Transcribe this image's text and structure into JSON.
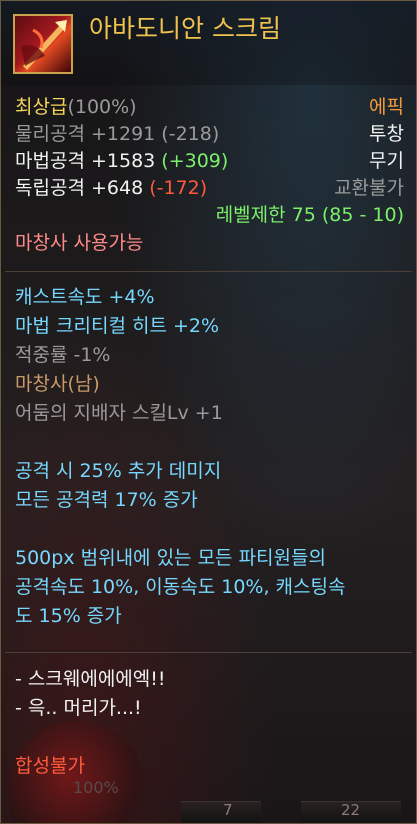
{
  "item": {
    "name": "아바도니안 스크림",
    "grade_label": "최상급",
    "grade_pct": "(100%)",
    "rarity": "에픽",
    "category_1": "투창",
    "category_2": "무기",
    "trade": "교환불가",
    "level_limit": "레벨제한 75 (85 - 10)",
    "usable": "마창사 사용가능",
    "accent_colors": {
      "name": "#f0c24e",
      "rarity": "#f39a3c",
      "plus": "#7cf06a",
      "minus": "#ff5a3c",
      "option": "#76d8ff"
    }
  },
  "stats": [
    {
      "label": "물리공격",
      "value": "+1291",
      "diff": "(-218)",
      "tone": "gray"
    },
    {
      "label": "마법공격",
      "value": "+1583",
      "diff": "(+309)",
      "tone": "white"
    },
    {
      "label": "독립공격",
      "value": "+648",
      "diff": "(-172)",
      "tone": "white"
    }
  ],
  "options": [
    "캐스트속도 +4%",
    "마법 크리티컬 히트 +2%"
  ],
  "extra": {
    "hit_rate": "적중률 -1%",
    "class": "마창사(남)",
    "skill": "어둠의 지배자 스킬Lv +1"
  },
  "effects": [
    "공격 시 25% 추가 데미지",
    "모든 공격력 17% 증가",
    "500px 범위내에 있는 모든 파티원들의",
    "공격속도 10%, 이동속도 10%, 캐스팅속",
    "도 15% 증가"
  ],
  "flavor": [
    "- 스크웨에에에엑!!",
    "- 윽.. 머리가...!"
  ],
  "footer": {
    "synthesis": "합성불가",
    "bg_text_1": "100%",
    "bg_text_2": "7",
    "bg_text_3": "22"
  },
  "icons": [
    "spear-item-icon"
  ]
}
